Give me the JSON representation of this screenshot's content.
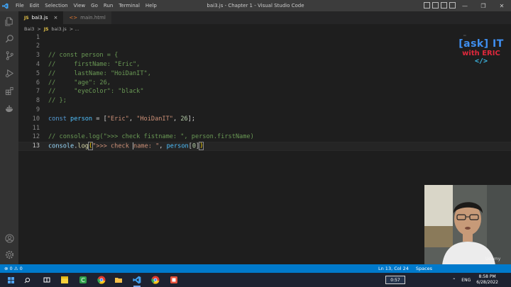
{
  "window": {
    "title": "bai3.js - Chapter 1 - Visual Studio Code",
    "menu": [
      "File",
      "Edit",
      "Selection",
      "View",
      "Go",
      "Run",
      "Terminal",
      "Help"
    ],
    "controls": {
      "minimize": "—",
      "maximize": "❐",
      "close": "✕"
    }
  },
  "tabs": [
    {
      "icon": "JS",
      "label": "bai3.js",
      "active": true,
      "close": "×"
    },
    {
      "icon": "<>",
      "label": "main.html",
      "active": false
    }
  ],
  "breadcrumb": {
    "folder": "Bai3",
    "sep": ">",
    "file_icon": "JS",
    "file": "bai3.js",
    "tail": "> ..."
  },
  "editor": {
    "current_line": 13,
    "lines": [
      {
        "n": "1"
      },
      {
        "n": "2"
      },
      {
        "n": "3",
        "parts": [
          {
            "c": "c-comment",
            "t": "// const person = {"
          }
        ]
      },
      {
        "n": "4",
        "parts": [
          {
            "c": "c-comment",
            "t": "//     firstName: \"Eric\","
          }
        ]
      },
      {
        "n": "5",
        "parts": [
          {
            "c": "c-comment",
            "t": "//     lastName: \"HoiDanIT\","
          }
        ]
      },
      {
        "n": "6",
        "parts": [
          {
            "c": "c-comment",
            "t": "//     \"age\": 26,"
          }
        ]
      },
      {
        "n": "7",
        "parts": [
          {
            "c": "c-comment",
            "t": "//     \"eyeColor\": \"black\""
          }
        ]
      },
      {
        "n": "8",
        "parts": [
          {
            "c": "c-comment",
            "t": "// };"
          }
        ]
      },
      {
        "n": "9"
      },
      {
        "n": "10",
        "parts": [
          {
            "c": "c-kw",
            "t": "const "
          },
          {
            "c": "c-var",
            "t": "person"
          },
          {
            "c": "c-plain",
            "t": " = ["
          },
          {
            "c": "c-str",
            "t": "\"Eric\""
          },
          {
            "c": "c-plain",
            "t": ", "
          },
          {
            "c": "c-str",
            "t": "\"HoiDanIT\""
          },
          {
            "c": "c-plain",
            "t": ", "
          },
          {
            "c": "c-num",
            "t": "26"
          },
          {
            "c": "c-plain",
            "t": "];"
          }
        ]
      },
      {
        "n": "11"
      },
      {
        "n": "12",
        "parts": [
          {
            "c": "c-comment",
            "t": "// console.log(\">>> check fistname: \", person.firstName)"
          }
        ]
      },
      {
        "n": "13",
        "parts": [
          {
            "c": "c-prop",
            "t": "console"
          },
          {
            "c": "c-plain",
            "t": "."
          },
          {
            "c": "c-fn",
            "t": "log"
          },
          {
            "c": "c-bracket match-box",
            "t": "("
          },
          {
            "c": "c-str",
            "t": "\">>> check "
          },
          {
            "c": "cursor",
            "t": ""
          },
          {
            "c": "c-str",
            "t": "name: \""
          },
          {
            "c": "c-plain",
            "t": ", "
          },
          {
            "c": "c-var",
            "t": "person"
          },
          {
            "c": "c-plain",
            "t": "["
          },
          {
            "c": "c-num",
            "t": "0"
          },
          {
            "c": "c-plain",
            "t": "]"
          },
          {
            "c": "c-bracket match-box",
            "t": ")"
          }
        ]
      }
    ]
  },
  "watermark": {
    "title": "[ask] IT",
    "subtitle": "with ERIC",
    "code": "</>"
  },
  "overlay": {
    "udemy": "Udemy"
  },
  "statusbar": {
    "problems": "⊗ 0 ⚠ 0",
    "position": "Ln 13, Col 24",
    "spaces": "Spaces"
  },
  "taskbar": {
    "playback_speed": "0:57",
    "language": "ENG",
    "time": "8:58 PM",
    "date": "6/28/2022"
  }
}
